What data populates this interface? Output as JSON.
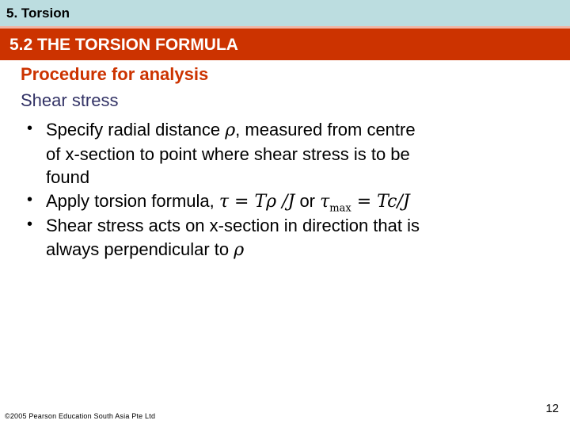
{
  "header": {
    "chapter": "5. Torsion",
    "section": "5.2 THE TORSION FORMULA",
    "chapter_band_color": "#bcdde0",
    "section_band_color": "#cc3300",
    "divider_color": "#f0b5a5"
  },
  "body": {
    "procedure_heading": "Procedure for analysis",
    "procedure_heading_color": "#cc3300",
    "subheading": "Shear stress",
    "subheading_color": "#333366",
    "bullet_marker": "•",
    "bullets": [
      {
        "lines": [
          {
            "pre": "Specify radial distance ",
            "greek": "ρ",
            "post": ", measured from centre"
          },
          {
            "pre": "of x-section to point where shear stress is to be",
            "greek": "",
            "post": ""
          },
          {
            "pre": "found",
            "greek": "",
            "post": ""
          }
        ]
      },
      {
        "formula": {
          "lead": "Apply torsion formula, ",
          "tau": "τ",
          "eq1": " = ",
          "T1": "T",
          "rho": "ρ",
          "slashJ1": " /J",
          "or": " or ",
          "tau2": "τ",
          "sub": "max",
          "eq2": " = ",
          "T2": "Tc",
          "slashJ2": "/J"
        }
      },
      {
        "lines": [
          {
            "pre": "Shear stress acts on x-section in direction that is",
            "greek": "",
            "post": ""
          },
          {
            "pre": "always perpendicular to ",
            "greek": "ρ",
            "post": ""
          }
        ]
      }
    ]
  },
  "footer": {
    "copyright": "©2005 Pearson Education South Asia Pte Ltd",
    "page_number": "12"
  }
}
